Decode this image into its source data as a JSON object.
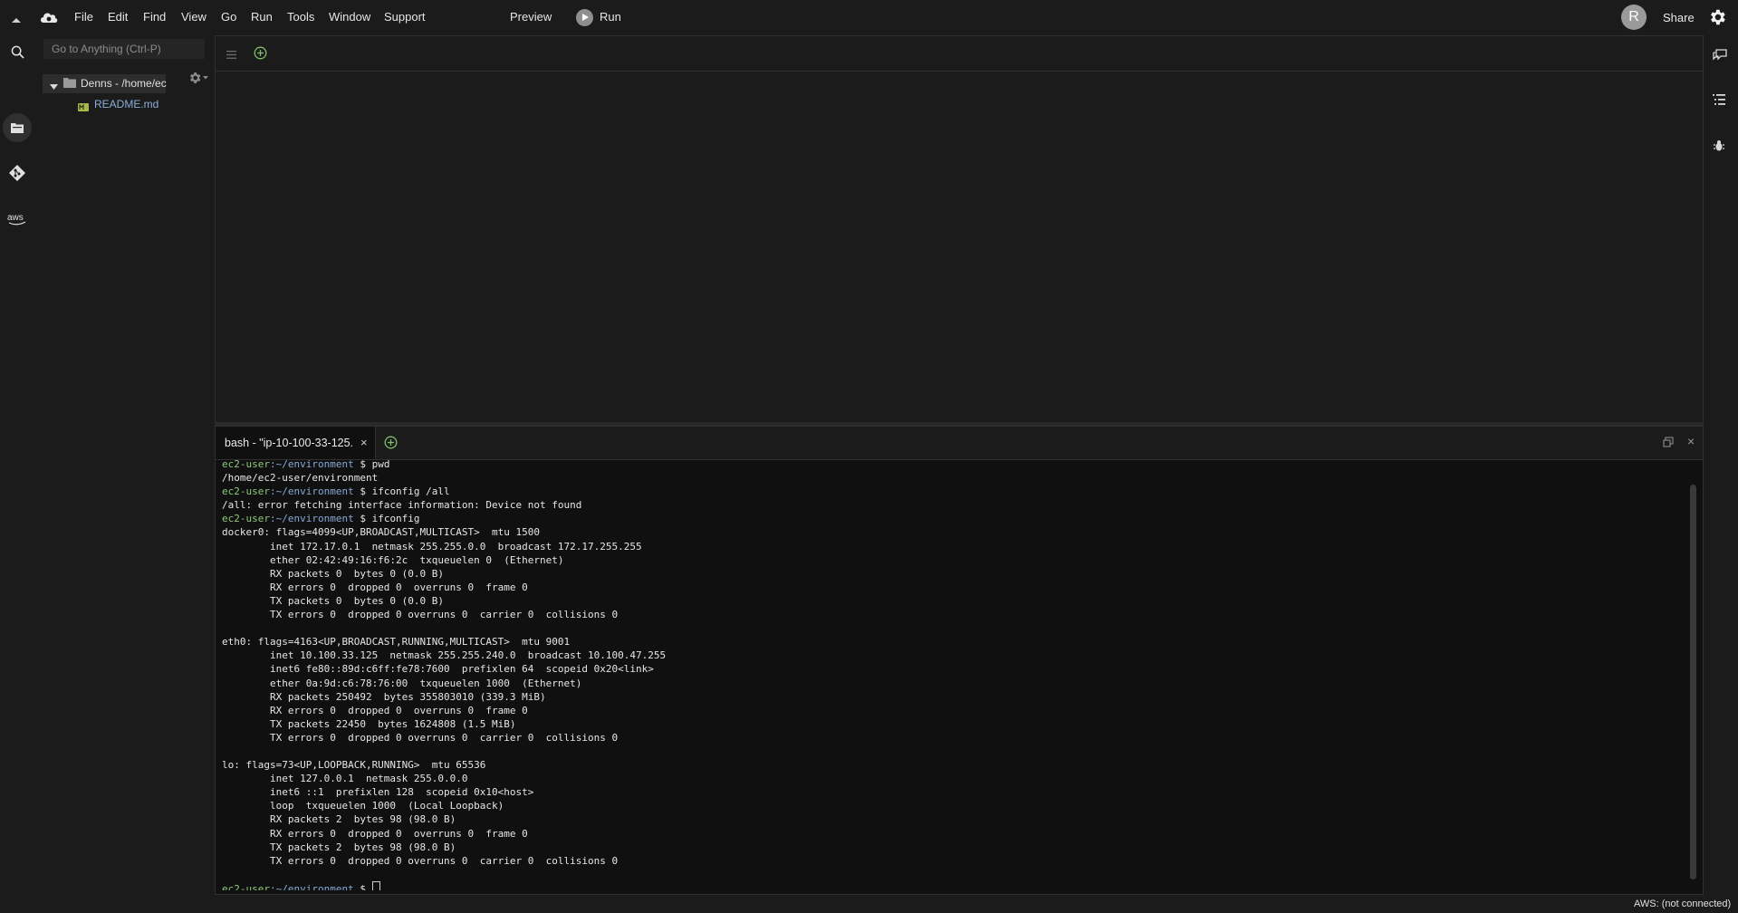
{
  "menu": {
    "items": [
      "File",
      "Edit",
      "Find",
      "View",
      "Go",
      "Run",
      "Tools",
      "Window",
      "Support"
    ],
    "preview": "Preview",
    "run": "Run",
    "avatar_letter": "R",
    "share": "Share"
  },
  "tree": {
    "goto_placeholder": "Go to Anything (Ctrl-P)",
    "root": "Denns - /home/ec",
    "files": [
      "README.md"
    ]
  },
  "terminal": {
    "tab_label": "bash - \"ip-10-100-33-125.",
    "tab_close": "×",
    "close": "×",
    "lines": [
      {
        "prompt_user": "ec2-user",
        "prompt_path": ":~/environment",
        "cmd": " $ pwd"
      },
      {
        "text": "/home/ec2-user/environment"
      },
      {
        "prompt_user": "ec2-user",
        "prompt_path": ":~/environment",
        "cmd": " $ ifconfig /all"
      },
      {
        "text": "/all: error fetching interface information: Device not found"
      },
      {
        "prompt_user": "ec2-user",
        "prompt_path": ":~/environment",
        "cmd": " $ ifconfig"
      },
      {
        "text": "docker0: flags=4099<UP,BROADCAST,MULTICAST>  mtu 1500"
      },
      {
        "text": "        inet 172.17.0.1  netmask 255.255.0.0  broadcast 172.17.255.255"
      },
      {
        "text": "        ether 02:42:49:16:f6:2c  txqueuelen 0  (Ethernet)"
      },
      {
        "text": "        RX packets 0  bytes 0 (0.0 B)"
      },
      {
        "text": "        RX errors 0  dropped 0  overruns 0  frame 0"
      },
      {
        "text": "        TX packets 0  bytes 0 (0.0 B)"
      },
      {
        "text": "        TX errors 0  dropped 0 overruns 0  carrier 0  collisions 0"
      },
      {
        "text": ""
      },
      {
        "text": "eth0: flags=4163<UP,BROADCAST,RUNNING,MULTICAST>  mtu 9001"
      },
      {
        "text": "        inet 10.100.33.125  netmask 255.255.240.0  broadcast 10.100.47.255"
      },
      {
        "text": "        inet6 fe80::89d:c6ff:fe78:7600  prefixlen 64  scopeid 0x20<link>"
      },
      {
        "text": "        ether 0a:9d:c6:78:76:00  txqueuelen 1000  (Ethernet)"
      },
      {
        "text": "        RX packets 250492  bytes 355803010 (339.3 MiB)"
      },
      {
        "text": "        RX errors 0  dropped 0  overruns 0  frame 0"
      },
      {
        "text": "        TX packets 22450  bytes 1624808 (1.5 MiB)"
      },
      {
        "text": "        TX errors 0  dropped 0 overruns 0  carrier 0  collisions 0"
      },
      {
        "text": ""
      },
      {
        "text": "lo: flags=73<UP,LOOPBACK,RUNNING>  mtu 65536"
      },
      {
        "text": "        inet 127.0.0.1  netmask 255.0.0.0"
      },
      {
        "text": "        inet6 ::1  prefixlen 128  scopeid 0x10<host>"
      },
      {
        "text": "        loop  txqueuelen 1000  (Local Loopback)"
      },
      {
        "text": "        RX packets 2  bytes 98 (98.0 B)"
      },
      {
        "text": "        RX errors 0  dropped 0  overruns 0  frame 0"
      },
      {
        "text": "        TX packets 2  bytes 98 (98.0 B)"
      },
      {
        "text": "        TX errors 0  dropped 0 overruns 0  carrier 0  collisions 0"
      },
      {
        "text": ""
      },
      {
        "prompt_user": "ec2-user",
        "prompt_path": ":~/environment",
        "cmd": " $ ",
        "cursor": true
      }
    ]
  },
  "status": {
    "aws": "AWS: (not connected)"
  },
  "colors": {
    "accent_green": "#8fc97a",
    "prompt_path_blue": "#86a9d6",
    "link_blue": "#8aaed8"
  },
  "icons": {
    "left": [
      "search-icon",
      "files-icon",
      "git-icon",
      "aws-icon"
    ],
    "right": [
      "chat-icon",
      "outline-icon",
      "debugger-icon"
    ]
  }
}
